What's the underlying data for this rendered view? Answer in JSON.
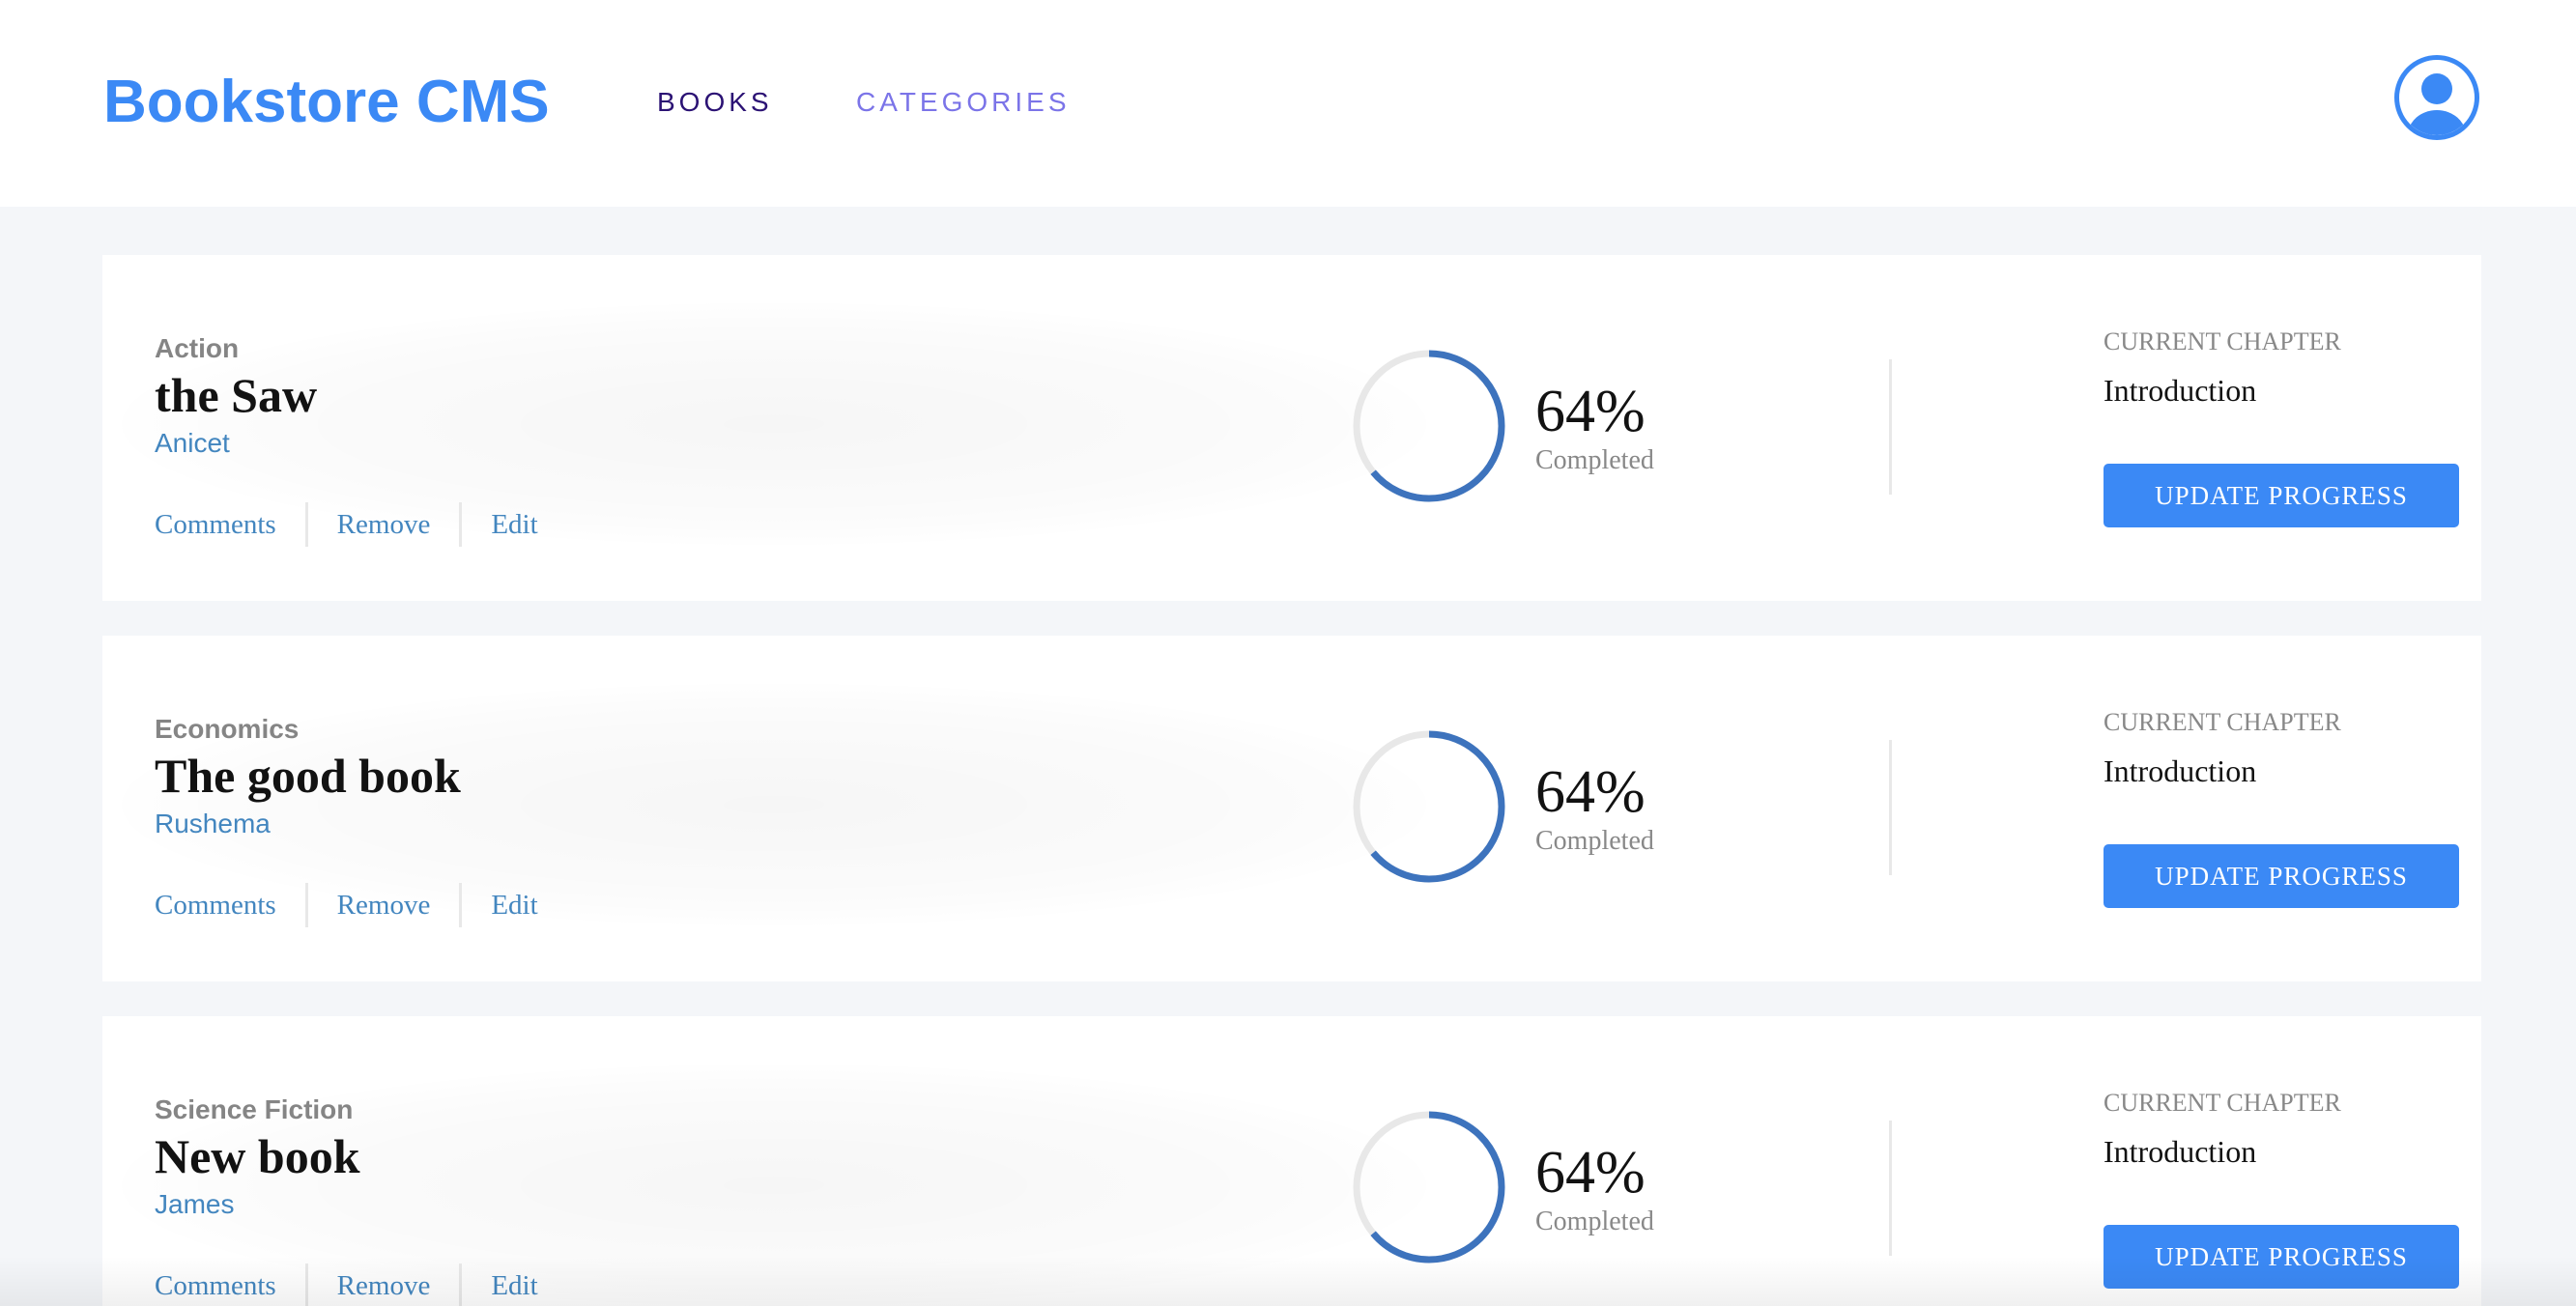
{
  "header": {
    "logo": "Bookstore CMS",
    "nav": [
      {
        "label": "BOOKS",
        "active": true
      },
      {
        "label": "CATEGORIES",
        "active": false
      }
    ],
    "user_icon": "user-circle-icon"
  },
  "colors": {
    "brand": "#3b89f5",
    "nav_active": "#2b1274",
    "nav_inactive": "#7b74e8",
    "link": "#4386bf",
    "progress": "#3d73bd",
    "progress_track": "#e8e8e8"
  },
  "books": [
    {
      "genre": "Action",
      "title": "the Saw",
      "author": "Anicet",
      "actions": {
        "comments": "Comments",
        "remove": "Remove",
        "edit": "Edit"
      },
      "progress_percent": 64,
      "percent_label": "64%",
      "completed_label": "Completed",
      "chapter_label": "CURRENT CHAPTER",
      "chapter": "Introduction",
      "update_label": "UPDATE PROGRESS"
    },
    {
      "genre": "Economics",
      "title": "The good book",
      "author": "Rushema",
      "actions": {
        "comments": "Comments",
        "remove": "Remove",
        "edit": "Edit"
      },
      "progress_percent": 64,
      "percent_label": "64%",
      "completed_label": "Completed",
      "chapter_label": "CURRENT CHAPTER",
      "chapter": "Introduction",
      "update_label": "UPDATE PROGRESS"
    },
    {
      "genre": "Science Fiction",
      "title": "New book",
      "author": "James",
      "actions": {
        "comments": "Comments",
        "remove": "Remove",
        "edit": "Edit"
      },
      "progress_percent": 64,
      "percent_label": "64%",
      "completed_label": "Completed",
      "chapter_label": "CURRENT CHAPTER",
      "chapter": "Introduction",
      "update_label": "UPDATE PROGRESS"
    }
  ]
}
